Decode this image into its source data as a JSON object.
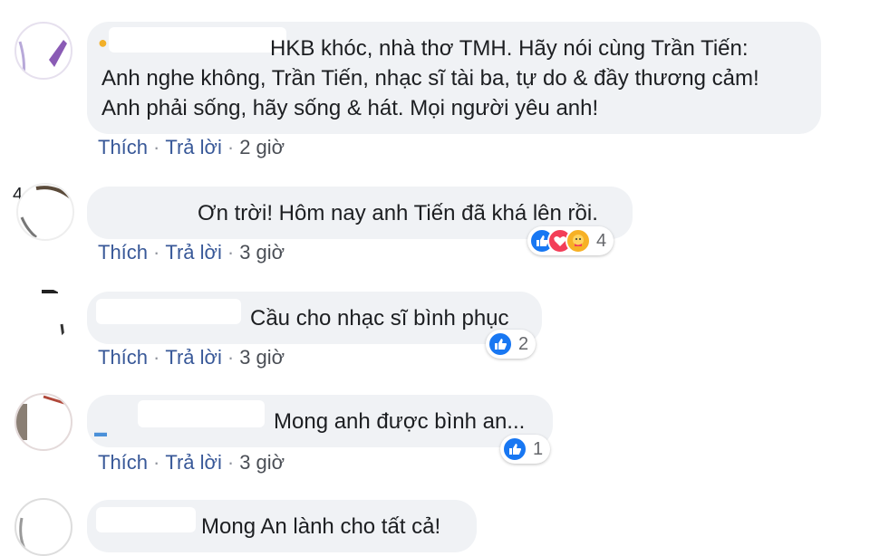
{
  "comments": [
    {
      "lines": [
        "HKB khóc, nhà thơ TMH. Hãy nói cùng Trần Tiến:",
        "Anh nghe không, Trần Tiến, nhạc sĩ tài ba, tự do & đầy thương cảm!",
        "Anh phải sống, hãy sống & hát. Mọi người yêu anh!"
      ],
      "like_label": "Thích",
      "reply_label": "Trả lời",
      "time": "2 giờ"
    },
    {
      "lines": [
        "Ơn trời! Hôm nay anh Tiến đã khá lên rồi."
      ],
      "like_label": "Thích",
      "reply_label": "Trả lời",
      "time": "3 giờ",
      "reaction_count": "4",
      "reactions": [
        "like-icon",
        "love-icon",
        "care-icon"
      ]
    },
    {
      "lines": [
        "Cầu cho nhạc sĩ bình phục"
      ],
      "like_label": "Thích",
      "reply_label": "Trả lời",
      "time": "3 giờ",
      "reaction_count": "2",
      "reactions": [
        "like-icon"
      ]
    },
    {
      "lines": [
        "Mong anh được bình an..."
      ],
      "like_label": "Thích",
      "reply_label": "Trả lời",
      "time": "3 giờ",
      "reaction_count": "1",
      "reactions": [
        "like-icon"
      ]
    },
    {
      "lines": [
        "Mong An lành cho tất cả!"
      ]
    }
  ],
  "edge_number": "4",
  "colors": {
    "bubble_bg": "#f0f2f5",
    "link": "#385898",
    "like_blue": "#1877f2",
    "love_red": "#f33e58",
    "care_yellow": "#f7b125"
  }
}
